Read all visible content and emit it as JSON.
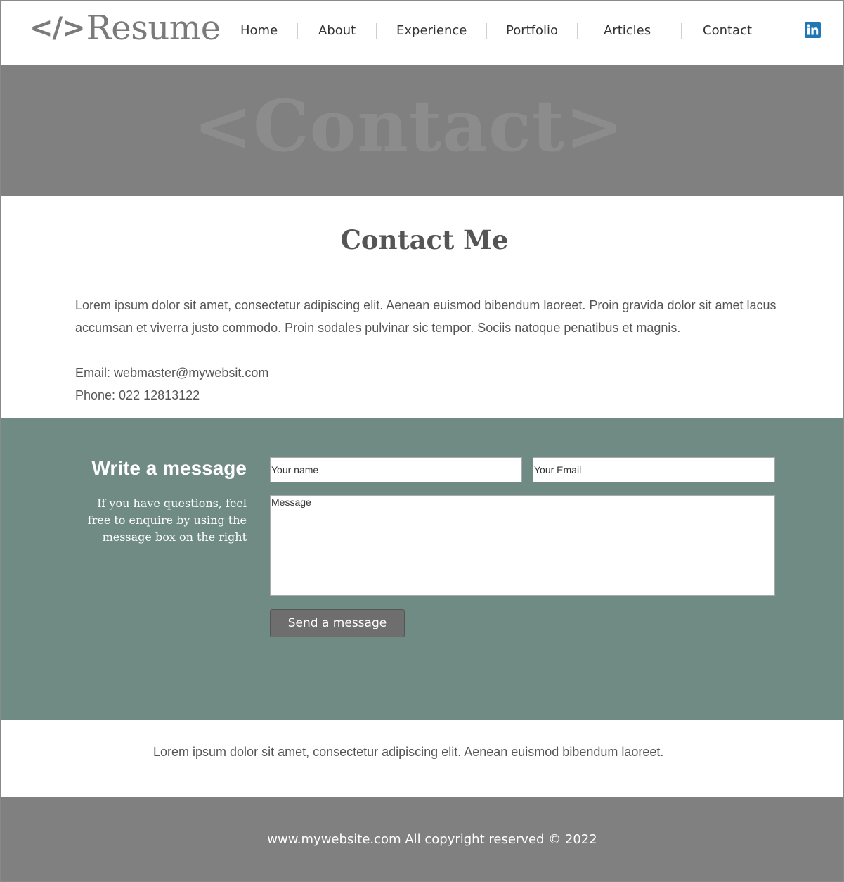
{
  "header": {
    "logo_mark": "</>",
    "logo_text": "Resume",
    "nav": [
      "Home",
      "About",
      "Experience",
      "Portfolio",
      "Articles",
      "Contact"
    ],
    "social_icon": "linkedin-icon"
  },
  "banner": {
    "text": "<Contact>"
  },
  "contact": {
    "title": "Contact Me",
    "intro": "Lorem ipsum dolor sit amet, consectetur adipiscing elit. Aenean euismod bibendum laoreet. Proin gravida dolor sit amet lacus accumsan et viverra justo commodo. Proin sodales pulvinar sic tempor. Sociis natoque penatibus et magnis.",
    "email_line": "Email: webmaster@mywebsit.com",
    "phone_line": "Phone: 022 12813122"
  },
  "message": {
    "title": "Write a message",
    "description": "If you have questions, feel free to enquire by using the message box on the right",
    "name_placeholder": "Your name",
    "email_placeholder": "Your Email",
    "message_placeholder": "Message",
    "send_label": "Send a message"
  },
  "bottom": {
    "text": "Lorem ipsum dolor sit amet, consectetur adipiscing elit. Aenean euismod bibendum laoreet."
  },
  "footer": {
    "text": "www.mywebsite.com All copyright reserved © 2022"
  },
  "colors": {
    "banner": "#808080",
    "message_section": "#6f8b83",
    "footer": "#808080",
    "linkedin": "#2176b5",
    "send_button": "#6e6e6e"
  }
}
